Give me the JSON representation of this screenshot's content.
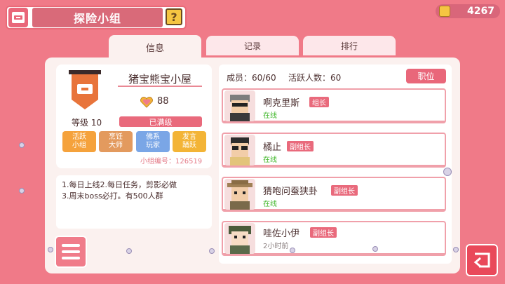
{
  "header": {
    "title": "探险小组",
    "help_label": "?"
  },
  "coins": {
    "value": "4267",
    "icon": "coin-icon"
  },
  "tabs": [
    {
      "label": "信息",
      "active": true
    },
    {
      "label": "记录",
      "active": false
    },
    {
      "label": "排行",
      "active": false
    }
  ],
  "group": {
    "name": "猪宝熊宝小屋",
    "level_label": "等级 10",
    "points": "88",
    "max_level_text": "已满级",
    "id_text": "小组编号：126519",
    "tags": [
      {
        "line1": "活跃",
        "line2": "小组"
      },
      {
        "line1": "烹饪",
        "line2": "大师"
      },
      {
        "line1": "佛系",
        "line2": "玩家"
      },
      {
        "line1": "发言",
        "line2": "踊跃"
      }
    ]
  },
  "notice": {
    "line1": "1.每日上线2.每日任务，剪影必做",
    "line2": "3.周末boss必打。有500人群"
  },
  "members_panel": {
    "member_count": "成员：60/60",
    "active_count": "活跃人数：60",
    "position_button": "职位",
    "members": [
      {
        "name": "啊克里斯",
        "role": "组长",
        "status": "在线"
      },
      {
        "name": "橘止",
        "role": "副组长",
        "status": "在线"
      },
      {
        "name": "猜咆问蚕狭卦",
        "role": "副组长",
        "status": "在线"
      },
      {
        "name": "哇佐小伊",
        "role": "副组长",
        "status": "2小时前"
      }
    ]
  },
  "colors": {
    "background": "#f07a88",
    "accent": "#e9677a",
    "online": "#44b82e",
    "offline": "#8a7f7f"
  }
}
